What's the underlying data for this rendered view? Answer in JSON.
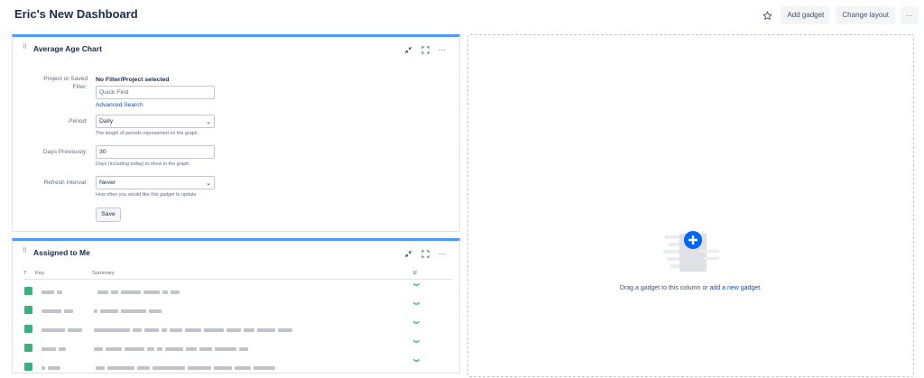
{
  "header": {
    "title": "Eric's New Dashboard",
    "add_gadget": "Add gadget",
    "change_layout": "Change layout",
    "more": "···"
  },
  "age_chart": {
    "title": "Average Age Chart",
    "project_label_line1": "Project or Saved",
    "project_label_line2": "Filter:",
    "no_selection": "No Filter/Project selected",
    "quick_find_placeholder": "Quick Find",
    "advanced_search": "Advanced Search",
    "period_label": "Period:",
    "period_value": "Daily",
    "period_hint": "The length of periods represented on the graph.",
    "days_label": "Days Previously:",
    "days_value": "30",
    "days_hint": "Days (including today) to show in the graph.",
    "refresh_label": "Refresh Interval:",
    "refresh_value": "Never",
    "refresh_hint": "How often you would like this gadget to update",
    "save": "Save"
  },
  "assigned": {
    "title": "Assigned to Me",
    "col_type": "T",
    "col_key": "Key",
    "col_summary": "Summary",
    "col_priority": "P"
  },
  "dropzone": {
    "text": "Drag a gadget to this column or",
    "link": "add a new gadget",
    "end": "."
  },
  "colors": {
    "accent": "#4c9aff",
    "link": "#0052cc",
    "story_green": "#36b37e"
  }
}
